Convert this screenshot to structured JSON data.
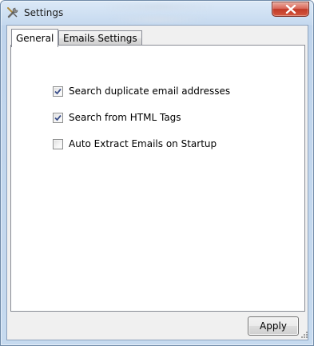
{
  "window": {
    "title": "Settings",
    "icon": "tools-icon",
    "close_icon": "close-icon",
    "close_color": "#c13a27"
  },
  "tabs": [
    {
      "label": "General",
      "active": true
    },
    {
      "label": "Emails Settings",
      "active": false
    }
  ],
  "general": {
    "options": [
      {
        "label": "Search duplicate email addresses",
        "checked": true
      },
      {
        "label": "Search from HTML Tags",
        "checked": true
      },
      {
        "label": "Auto Extract Emails on Startup",
        "checked": false
      }
    ]
  },
  "footer": {
    "apply_label": "Apply"
  }
}
